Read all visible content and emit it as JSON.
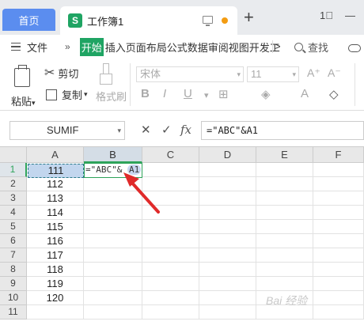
{
  "tabs": {
    "home": "首页",
    "doc_icon": "S",
    "doc_name": "工作簿1"
  },
  "window": {
    "new_tab": "+",
    "layout_icon": "1⃞",
    "minimize": "—"
  },
  "menu": {
    "file": "文件",
    "more": "»",
    "start": "开始",
    "items": "插入页面布局公式数据审阅视图开发工",
    "arrow": ">",
    "search": "查找"
  },
  "ribbon": {
    "paste": "粘贴",
    "cut": "剪切",
    "copy": "复制",
    "format_painter": "格式刷",
    "font": "宋体",
    "font_size": "11",
    "bold": "B",
    "italic": "I",
    "underline": "U"
  },
  "formula_bar": {
    "name_box": "SUMIF",
    "cancel": "✕",
    "confirm": "✓",
    "fx": "fx",
    "formula": "=\"ABC\"&A1"
  },
  "sheet": {
    "columns": [
      "A",
      "B",
      "C",
      "D",
      "E",
      "F"
    ],
    "active_column": "B",
    "rows": [
      "1",
      "2",
      "3",
      "4",
      "5",
      "6",
      "7",
      "8",
      "9",
      "10",
      "11"
    ],
    "col_a_values": [
      "111",
      "112",
      "113",
      "114",
      "115",
      "116",
      "117",
      "118",
      "119",
      "120"
    ],
    "b1_prefix": "=\"ABC\"& ",
    "b1_ref": "A1"
  },
  "colors": {
    "tab_home": "#5b8def",
    "wps_green": "#1fa463",
    "selection_green": "#2ea35a",
    "arrow_red": "#e02a2a"
  },
  "watermark": "Bai 经验"
}
